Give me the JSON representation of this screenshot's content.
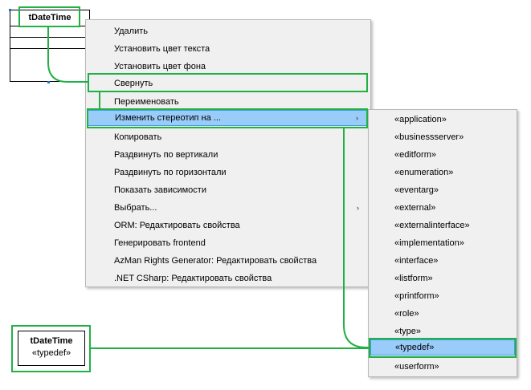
{
  "diagram": {
    "class_name": "tDateTime",
    "bottom_class": {
      "name": "tDateTime",
      "stereotype": "«typedef»"
    }
  },
  "context_menu": {
    "items": [
      {
        "label": "Удалить"
      },
      {
        "label": "Установить цвет текста"
      },
      {
        "label": "Установить цвет фона"
      },
      {
        "label": "Свернуть"
      },
      {
        "label": "Переименовать"
      },
      {
        "label": "Изменить стереотип на ...",
        "has_submenu": true,
        "arrow": "›"
      },
      {
        "label": "Копировать"
      },
      {
        "label": "Раздвинуть по вертикали"
      },
      {
        "label": "Раздвинуть по горизонтали"
      },
      {
        "label": "Показать зависимости"
      },
      {
        "label": "Выбрать...",
        "has_submenu": true,
        "arrow": "›"
      },
      {
        "label": "ORM: Редактировать свойства"
      },
      {
        "label": "Генерировать frontend"
      },
      {
        "label": "AzMan Rights Generator: Редактировать свойства"
      },
      {
        "label": ".NET CSharp: Редактировать свойства"
      }
    ]
  },
  "stereotype_submenu": {
    "items": [
      {
        "label": "«application»"
      },
      {
        "label": "«businessserver»"
      },
      {
        "label": "«editform»"
      },
      {
        "label": "«enumeration»"
      },
      {
        "label": "«eventarg»"
      },
      {
        "label": "«external»"
      },
      {
        "label": "«externalinterface»"
      },
      {
        "label": "«implementation»"
      },
      {
        "label": "«interface»"
      },
      {
        "label": "«listform»"
      },
      {
        "label": "«printform»"
      },
      {
        "label": "«role»"
      },
      {
        "label": "«type»"
      },
      {
        "label": "«typedef»"
      },
      {
        "label": "«userform»"
      }
    ]
  },
  "colors": {
    "highlight_frame": "#21b044",
    "menu_hover": "#99ccf8",
    "menu_background": "#f0f0f0"
  }
}
